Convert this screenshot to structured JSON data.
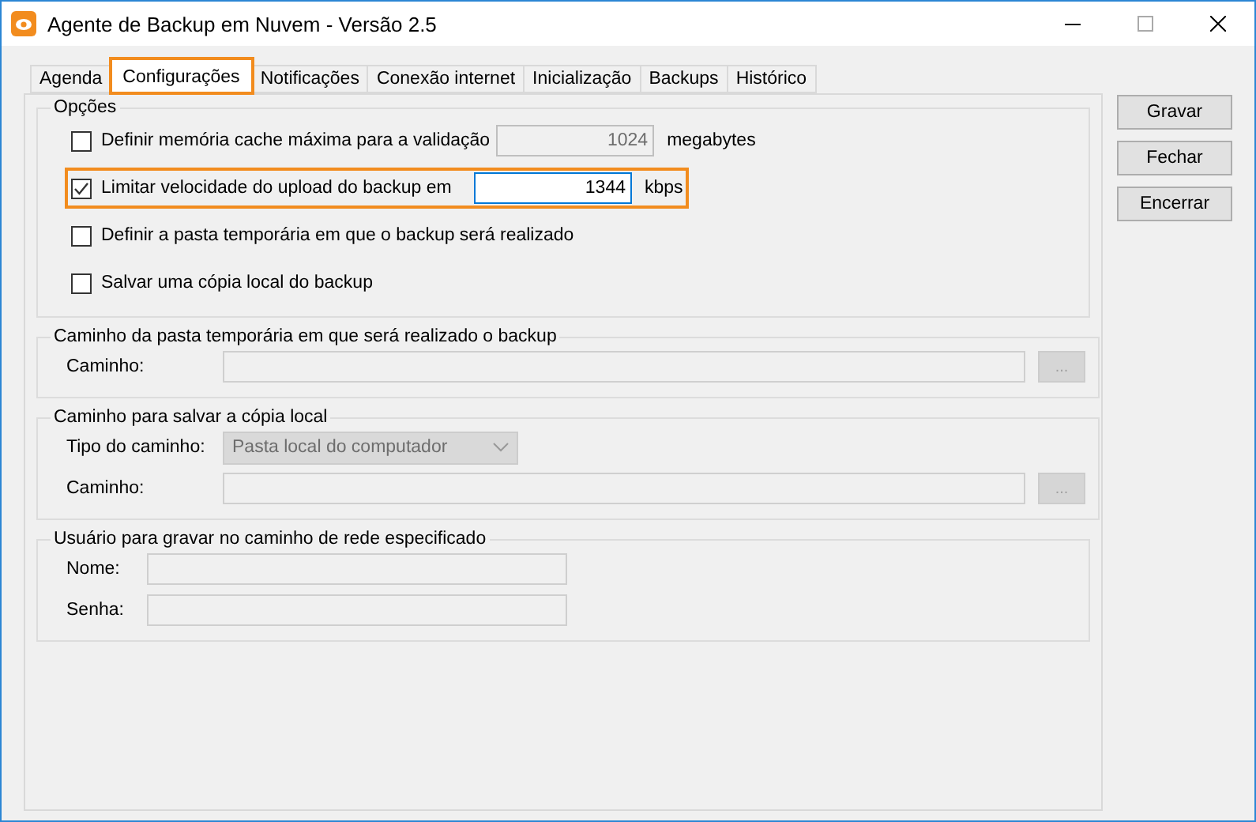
{
  "window": {
    "title": "Agente de Backup em Nuvem - Versão 2.5"
  },
  "tabs": [
    {
      "label": "Agenda",
      "selected": false,
      "highlighted": false
    },
    {
      "label": "Configurações",
      "selected": true,
      "highlighted": true
    },
    {
      "label": "Notificações",
      "selected": false,
      "highlighted": false
    },
    {
      "label": "Conexão internet",
      "selected": false,
      "highlighted": false
    },
    {
      "label": "Inicialização",
      "selected": false,
      "highlighted": false
    },
    {
      "label": "Backups",
      "selected": false,
      "highlighted": false
    },
    {
      "label": "Histórico",
      "selected": false,
      "highlighted": false
    }
  ],
  "options_group": {
    "title": "Opções",
    "options": [
      {
        "label": "Definir memória cache máxima para a validação",
        "checked": false,
        "highlighted": false,
        "field": {
          "value": "1024",
          "disabled": true
        },
        "unit": "megabytes"
      },
      {
        "label": "Limitar velocidade do upload do backup em",
        "checked": true,
        "highlighted": true,
        "field": {
          "value": "1344",
          "disabled": false
        },
        "unit": "kbps"
      },
      {
        "label": "Definir a pasta temporária em que o backup será realizado",
        "checked": false,
        "highlighted": false
      },
      {
        "label": "Salvar uma cópia local do backup",
        "checked": false,
        "highlighted": false
      }
    ]
  },
  "temp_folder_group": {
    "title": "Caminho da pasta temporária em que será realizado o backup",
    "disabled": true,
    "path_label": "Caminho:",
    "browse": "..."
  },
  "local_copy_group": {
    "title": "Caminho para salvar a cópia local",
    "disabled": true,
    "type_label": "Tipo do caminho:",
    "type_value": "Pasta local do computador",
    "path_label": "Caminho:",
    "browse": "..."
  },
  "user_group": {
    "title": "Usuário para gravar no caminho de rede especificado",
    "disabled": true,
    "name_label": "Nome:",
    "password_label": "Senha:"
  },
  "buttons": [
    "Gravar",
    "Fechar",
    "Encerrar"
  ]
}
